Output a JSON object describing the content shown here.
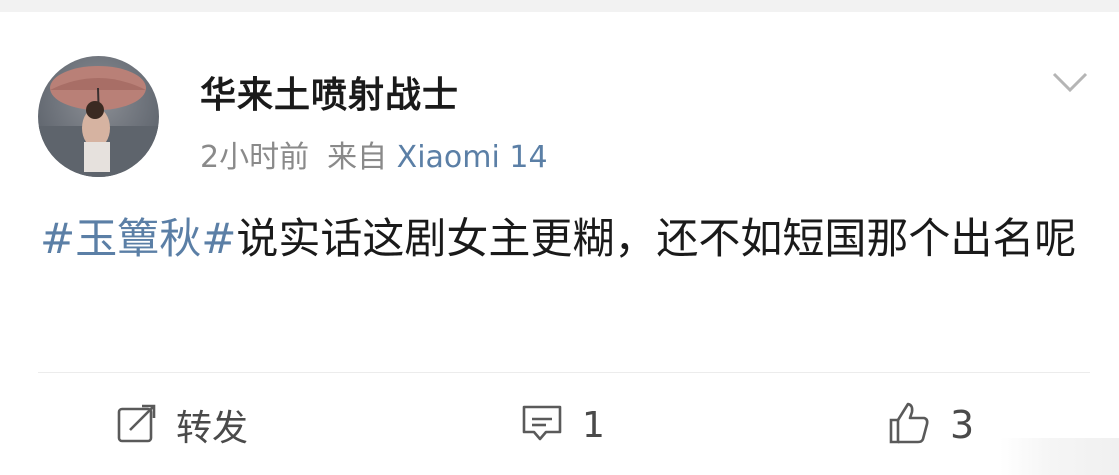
{
  "post": {
    "username": "华来土喷射战士",
    "time": "2小时前",
    "source_prefix": "来自",
    "device": "Xiaomi 14",
    "hashtag": "#玉簟秋#",
    "text": "说实话这剧女主更糊，还不如短国那个出名呢"
  },
  "actions": {
    "repost_label": "转发",
    "comment_count": "1",
    "like_count": "3"
  },
  "colors": {
    "link": "#5b7fa6",
    "meta": "#8a8a8a",
    "icon": "#5a5a5a"
  },
  "icons": [
    "chevron-down-icon",
    "repost-icon",
    "comment-icon",
    "like-icon"
  ]
}
